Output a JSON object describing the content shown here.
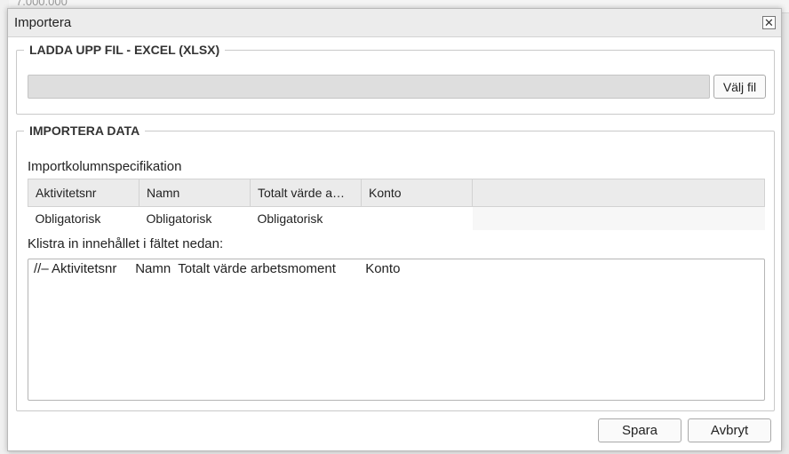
{
  "background": {
    "partial_number": "7.000.000"
  },
  "dialog": {
    "title": "Importera",
    "close_symbol": "✕"
  },
  "upload": {
    "legend": "LADDA UPP FIL - EXCEL (XLSX)",
    "file_value": "",
    "choose_label": "Välj fil"
  },
  "import": {
    "legend": "IMPORTERA DATA",
    "spec_label": "Importkolumnspecifikation",
    "columns": [
      "Aktivitetsnr",
      "Namn",
      "Totalt värde a…",
      "Konto"
    ],
    "requirements": [
      "Obligatorisk",
      "Obligatorisk",
      "Obligatorisk",
      ""
    ],
    "paste_label": "Klistra in innehållet i fältet nedan:",
    "paste_content": "//– Aktivitetsnr     Namn  Totalt värde arbetsmoment        Konto"
  },
  "actions": {
    "save_label": "Spara",
    "cancel_label": "Avbryt"
  }
}
